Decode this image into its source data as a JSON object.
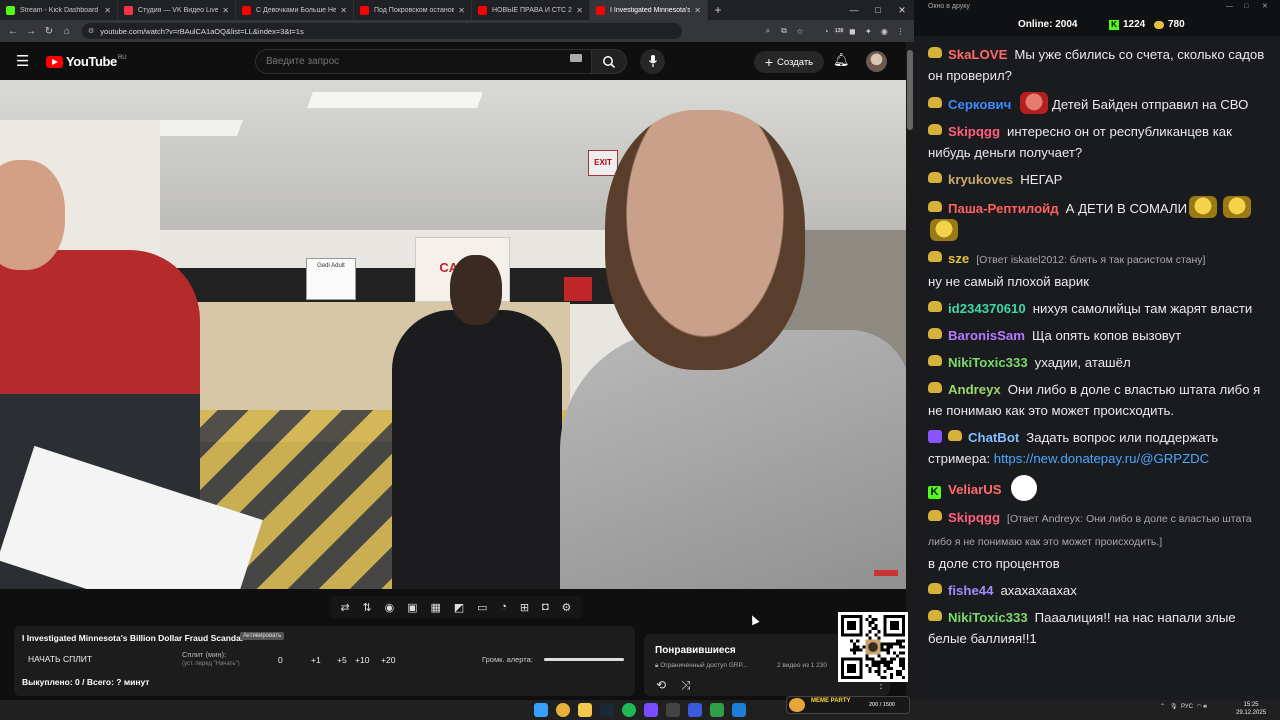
{
  "browser": {
    "tabs": [
      {
        "label": "Stream - Kick Dashboard",
        "color": "#53fc18"
      },
      {
        "label": "Студия — VK Видео Live",
        "color": "#ff3347"
      },
      {
        "label": "С Девочками Больше Не Хоте...",
        "color": "#ff0000"
      },
      {
        "label": "Под Покровском остановлен...",
        "color": "#ff0000"
      },
      {
        "label": "НОВЫЕ ПРАВА И СТС 2026 в...",
        "color": "#ff0000"
      },
      {
        "label": "I Investigated Minnesota's B...",
        "color": "#ff0000",
        "active": true
      }
    ],
    "url": "youtube.com/watch?v=rBAulCA1aOQ&list=LL&index=3&t=1s",
    "extension_badge": "139"
  },
  "youtube": {
    "logo": "YouTube",
    "country": "RU",
    "search_placeholder": "Введите запрос",
    "create_label": "Создать",
    "exit_sign": "EXIT",
    "video_sign": "Gedi Adult",
    "video_banner": "CANDY"
  },
  "split": {
    "video_title": "I Investigated Minnesota's Billion Dollar Fraud Scandal",
    "badge": "Активировать",
    "start_label": "НАЧАТЬ СПЛИТ",
    "split_label": "Сплит (мин):",
    "split_hint": "(уст. перед \"Начать\")",
    "split_value": "0",
    "increments": [
      "+1",
      "+5",
      "+10",
      "+20"
    ],
    "alert_label": "Громк. алерта:",
    "alert_volume": 1.0,
    "bought": "Выкуплено: 0 / Всего: ? минут"
  },
  "liked": {
    "title": "Понравившиеся",
    "meta": "Ограниченный доступ  GRP...",
    "count": "2 видео из 1 230"
  },
  "chat": {
    "window_title": "Окно в друку",
    "online_label": "Online:",
    "online_value": "2004",
    "kick_value": "1224",
    "coin_value": "780",
    "messages": [
      {
        "nick": "SkaLOVE",
        "color": "#ff6b6b",
        "text": "Мы уже сбились со счета, сколько садов он проверил?"
      },
      {
        "nick": "Серкович",
        "color": "#3b8bff",
        "text": "Детей Байден отправил на СВО"
      },
      {
        "nick": "Skipqgg",
        "color": "#ff5f7e",
        "text": "интересно он от республиканцев как нибудь деньги получает?"
      },
      {
        "nick": "kryukoves",
        "color": "#c8a96e",
        "text": "НЕГАР"
      },
      {
        "nick": "Паша-Рептилойд",
        "color": "#ff6060",
        "text": "А ДЕТИ В СОМАЛИ"
      },
      {
        "nick": "sze",
        "color": "#e3c041",
        "reply": "[Ответ iskatel2012: блять я так расистом стану]",
        "text": "ну не самый плохой варик"
      },
      {
        "nick": "id234370610",
        "color": "#3fd7a9",
        "text": "нихуя самолийцы там жарят власти"
      },
      {
        "nick": "BaronisSam",
        "color": "#b17bff",
        "text": "Ща опять копов вызовут"
      },
      {
        "nick": "NikiToxic333",
        "color": "#7bd96b",
        "text": "ухадии, аташёл"
      },
      {
        "nick": "Andreyx",
        "color": "#9ad86b",
        "text": "Они либо в доле с властью штата либо я не понимаю как это может происходить."
      },
      {
        "nick": "ChatBot",
        "color": "#7ec0ff",
        "text": "Задать вопрос или поддержать стримера:",
        "link": "https://new.donatepay.ru/@GRPZDC"
      },
      {
        "nick": "VeliarUS",
        "color": "#ff6b6b",
        "text": ""
      },
      {
        "nick": "Skipqgg",
        "color": "#ff5f7e",
        "reply": "[Ответ Andreyx: Они либо в доле с властью штата либо я не понимаю как это может происходить.]",
        "text": "в доле сто процентов"
      },
      {
        "nick": "fishe44",
        "color": "#9f8cff",
        "text": "ахахахаахах"
      },
      {
        "nick": "NikiToxic333",
        "color": "#7bd96b",
        "text": "Паaалиция!! на нас напали злые белые баллияя!!1"
      }
    ]
  },
  "taskbar": {
    "meme_label": "MEME PARTY",
    "meme_count": "200 / 1500",
    "lang": "РУС",
    "time": "15:25",
    "date": "29.12.2025"
  }
}
